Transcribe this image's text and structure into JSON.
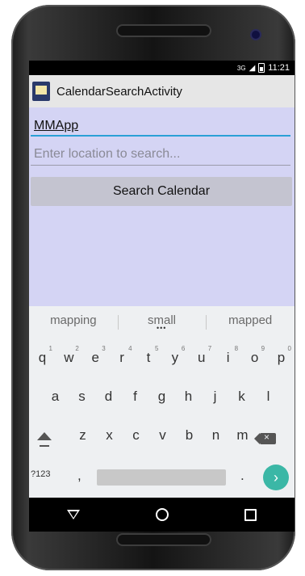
{
  "status": {
    "network": "3G",
    "time": "11:21"
  },
  "app": {
    "title": "CalendarSearchActivity",
    "icon": "calendar-app-icon"
  },
  "form": {
    "name_value": "MMApp",
    "location_placeholder": "Enter location to search...",
    "search_button": "Search Calendar"
  },
  "keyboard": {
    "suggestions": [
      "mapping",
      "small",
      "mapped"
    ],
    "row1": [
      "q",
      "w",
      "e",
      "r",
      "t",
      "y",
      "u",
      "i",
      "o",
      "p"
    ],
    "row1_hints": [
      "1",
      "2",
      "3",
      "4",
      "5",
      "6",
      "7",
      "8",
      "9",
      "0"
    ],
    "row2": [
      "a",
      "s",
      "d",
      "f",
      "g",
      "h",
      "j",
      "k",
      "l"
    ],
    "row3": [
      "z",
      "x",
      "c",
      "v",
      "b",
      "n",
      "m"
    ],
    "symbols_key": "?123",
    "comma_key": ",",
    "period_key": ".",
    "enter_icon": "arrow-right-icon",
    "accent": "#3bb7a6"
  },
  "nav": {
    "back_icon": "back-triangle-icon",
    "home_icon": "home-circle-icon",
    "recents_icon": "recents-square-icon"
  }
}
